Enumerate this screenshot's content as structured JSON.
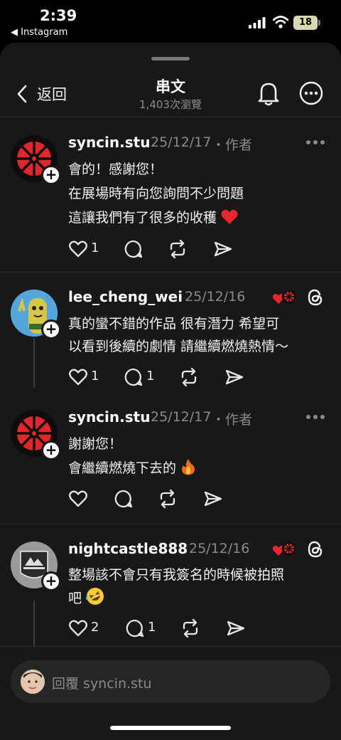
{
  "status": {
    "time": "2:39",
    "back_app": "◀ Instagram",
    "battery": "18"
  },
  "header": {
    "back_label": "返回",
    "title": "串文",
    "subtitle": "1,403次瀏覽"
  },
  "posts": [
    {
      "username": "syncin.stu",
      "date": "25/12/17",
      "tag": "・作者",
      "lines": [
        "會的！感謝您！",
        "在展場時有向您詢問不少問題",
        "這讓我們有了很多的收穫"
      ],
      "likes": "1",
      "replies": ""
    },
    {
      "username": "lee_cheng_wei",
      "date": "25/12/16",
      "tag": "",
      "lines": [
        "真的蠻不錯的作品 很有潛力 希望可",
        "以看到後續的劇情 請繼續燃燒熱情～"
      ],
      "likes": "1",
      "replies": "1"
    },
    {
      "username": "syncin.stu",
      "date": "25/12/17",
      "tag": "・作者",
      "lines": [
        "謝謝您！",
        "會繼續燃燒下去的"
      ],
      "likes": "",
      "replies": ""
    },
    {
      "username": "nightcastle888",
      "date": "25/12/16",
      "tag": "",
      "lines": [
        "整場該不會只有我簽名的時候被拍照",
        "吧"
      ],
      "likes": "2",
      "replies": "1"
    }
  ],
  "reply_bar": {
    "placeholder": "回覆 syncin.stu"
  },
  "icons": [
    "back-chevron-icon",
    "bell-icon",
    "more-icon",
    "heart-icon",
    "comment-icon",
    "repost-icon",
    "share-icon",
    "threads-icon",
    "plus-icon"
  ],
  "colors": {
    "background": "#000000",
    "sheet": "#181818",
    "accent_red": "#e0272a",
    "muted": "#8a8a8a"
  }
}
